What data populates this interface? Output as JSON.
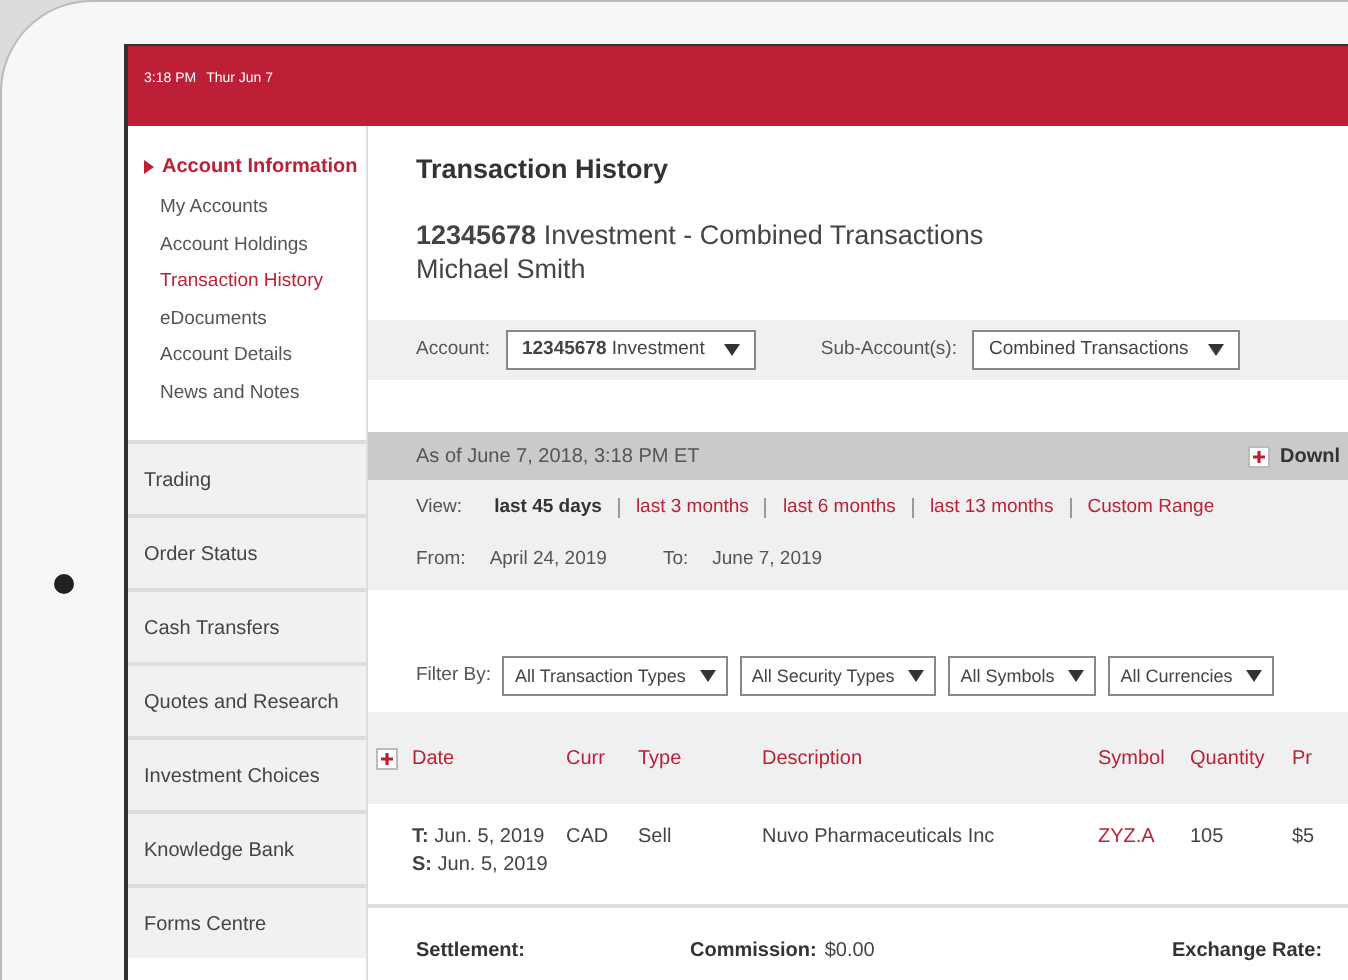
{
  "status_bar": {
    "time": "3:18 PM",
    "date": "Thur Jun 7"
  },
  "sidebar": {
    "section": {
      "label": "Account Information",
      "expanded": true,
      "children": [
        {
          "label": "My Accounts",
          "selected": false
        },
        {
          "label": "Account Holdings",
          "selected": false
        },
        {
          "label": "Transaction History",
          "selected": true
        },
        {
          "label": "eDocuments",
          "selected": false
        },
        {
          "label": "Account Details",
          "selected": false
        },
        {
          "label": "News and Notes",
          "selected": false
        }
      ]
    },
    "items": [
      "Trading",
      "Order Status",
      "Cash Transfers",
      "Quotes and Research",
      "Investment Choices",
      "Knowledge Bank",
      "Forms Centre"
    ]
  },
  "page": {
    "title": "Transaction History",
    "account": "**12345678** Investment - Combined Transactions",
    "holder": "Michael Smith"
  },
  "account_bar": {
    "account_label": "Account:",
    "account_value": "**12345678** Investment",
    "sub_label": "Sub-Account(s):",
    "sub_value": "Combined Transactions"
  },
  "as_of": "As of June 7, 2018, 3:18 PM ET",
  "download": "Downl",
  "view": {
    "label": "View:",
    "options": [
      {
        "label": "last 45 days",
        "selected": true
      },
      {
        "label": "last 3 months",
        "selected": false
      },
      {
        "label": "last 6 months",
        "selected": false
      },
      {
        "label": "last 13 months",
        "selected": false
      },
      {
        "label": "Custom Range",
        "selected": false
      }
    ]
  },
  "range": {
    "from_label": "From:",
    "from": "April 24, 2019",
    "to_label": "To:",
    "to": "June 7, 2019"
  },
  "filters": {
    "label": "Filter By:",
    "selects": [
      "All Transaction Types",
      "All Security Types",
      "All Symbols",
      "All Currencies"
    ]
  },
  "table": {
    "columns": [
      "Date",
      "Curr",
      "Type",
      "Description",
      "Symbol",
      "Quantity",
      "Pr"
    ],
    "rows": [
      {
        "cells": [
          [
            "**T:** Jun. 5, 2019",
            "**S:** Jun. 5, 2019"
          ],
          "CAD",
          "Sell",
          "Nuvo Pharmaceuticals Inc",
          "ZYZ.A",
          "105",
          "$5"
        ]
      }
    ],
    "details": [
      {
        "label": "Settlement:"
      },
      {
        "label": "Commission:",
        "value": "$0.00"
      },
      {
        "label": "Exchange Rate:"
      }
    ]
  }
}
